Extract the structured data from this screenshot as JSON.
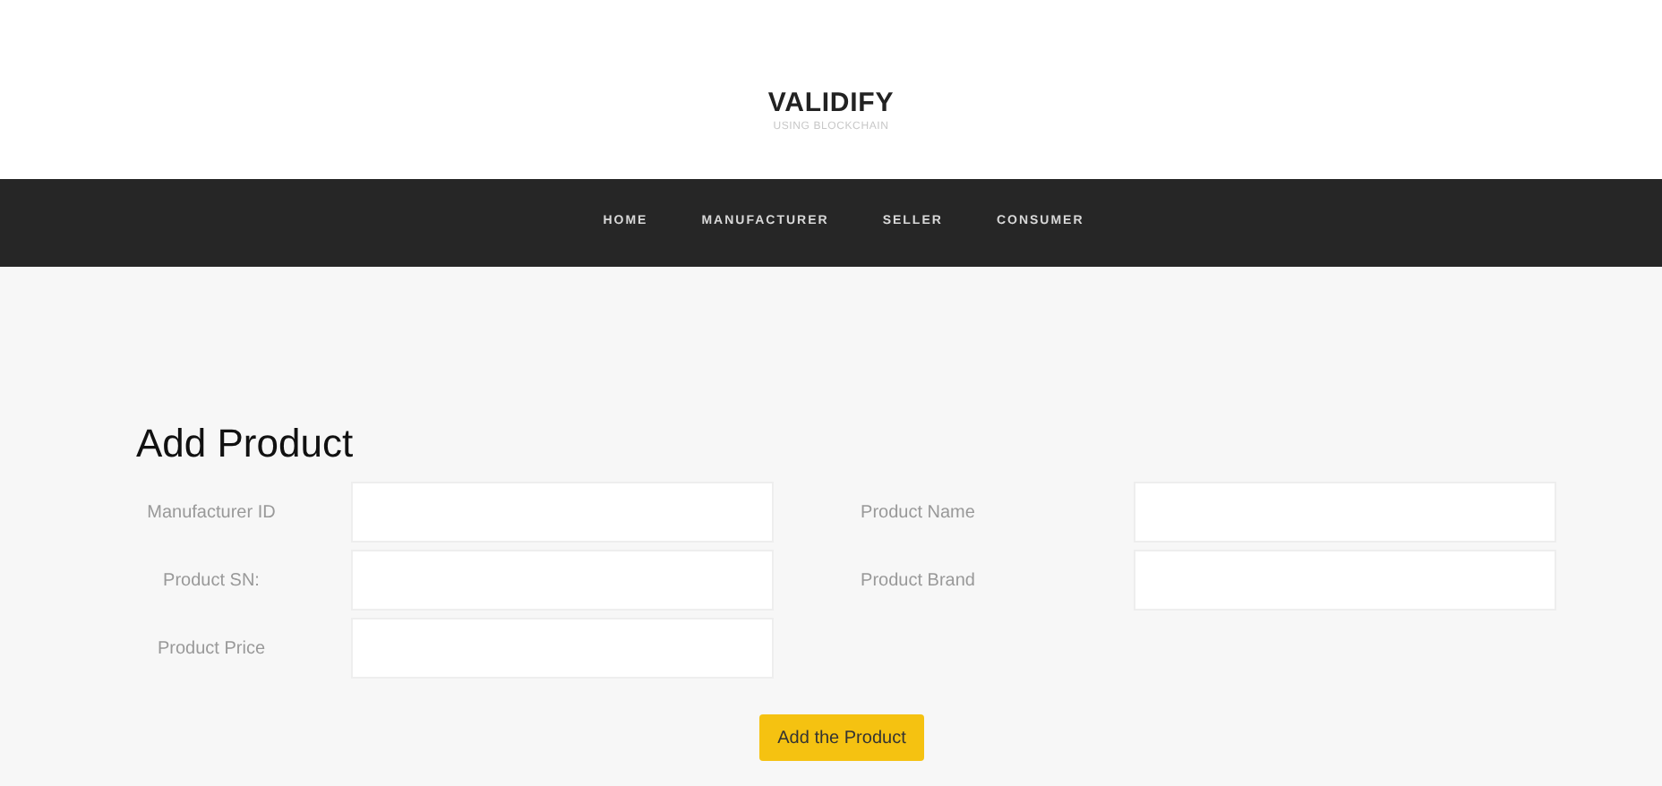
{
  "header": {
    "title": "VALIDIFY",
    "subtitle": "USING BLOCKCHAIN"
  },
  "nav": [
    {
      "label": "HOME"
    },
    {
      "label": "MANUFACTURER"
    },
    {
      "label": "SELLER"
    },
    {
      "label": "CONSUMER"
    }
  ],
  "form": {
    "title": "Add Product",
    "left_fields": [
      {
        "label": "Manufacturer ID"
      },
      {
        "label": "Product SN:"
      },
      {
        "label": "Product Price"
      }
    ],
    "right_fields": [
      {
        "label": "Product Name"
      },
      {
        "label": "Product Brand"
      }
    ],
    "submit": "Add the Product"
  }
}
